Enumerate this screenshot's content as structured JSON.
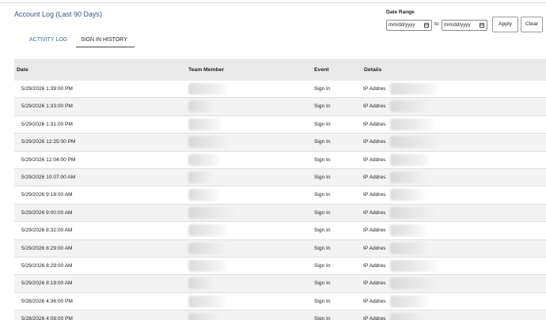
{
  "header": {
    "title": "Account Log (Last 90 Days)"
  },
  "date_range": {
    "label": "Date Range",
    "from_placeholder": "mm/dd/yyyy",
    "to_label": "to",
    "to_placeholder": "mm/dd/yyyy",
    "apply_label": "Apply",
    "clear_label": "Clear"
  },
  "tabs": [
    {
      "label": "ACTIVITY LOG",
      "active": false
    },
    {
      "label": "SIGN IN HISTORY",
      "active": true
    }
  ],
  "table": {
    "columns": [
      "Date",
      "Team Member",
      "Event",
      "Details"
    ],
    "rows": [
      {
        "date": "5/29/2026 1:39:00 PM",
        "event": "Sign In",
        "details": "IP Addres"
      },
      {
        "date": "5/29/2026 1:33:00 PM",
        "event": "Sign In",
        "details": "IP Addres"
      },
      {
        "date": "5/29/2026 1:31:00 PM",
        "event": "Sign In",
        "details": "IP Addres"
      },
      {
        "date": "5/29/2026 12:25:00 PM",
        "event": "Sign In",
        "details": "IP Addres"
      },
      {
        "date": "5/29/2026 12:04:00 PM",
        "event": "Sign In",
        "details": "IP Addres"
      },
      {
        "date": "5/29/2026 10:07:00 AM",
        "event": "Sign In",
        "details": "IP Addres"
      },
      {
        "date": "5/29/2026 9:18:00 AM",
        "event": "Sign In",
        "details": "IP Addres"
      },
      {
        "date": "5/29/2026 9:00:00 AM",
        "event": "Sign In",
        "details": "IP Addres"
      },
      {
        "date": "5/29/2026 8:32:00 AM",
        "event": "Sign In",
        "details": "IP Addres"
      },
      {
        "date": "5/29/2026 8:29:00 AM",
        "event": "Sign In",
        "details": "IP Addres"
      },
      {
        "date": "5/29/2026 8:29:00 AM",
        "event": "Sign In",
        "details": "IP Addres"
      },
      {
        "date": "5/29/2026 8:19:00 AM",
        "event": "Sign In",
        "details": "IP Addres"
      },
      {
        "date": "5/28/2026 4:36:00 PM",
        "event": "Sign In",
        "details": "IP Addres"
      },
      {
        "date": "5/28/2026 4:08:00 PM",
        "event": "Sign In",
        "details": "IP Addres"
      }
    ]
  }
}
